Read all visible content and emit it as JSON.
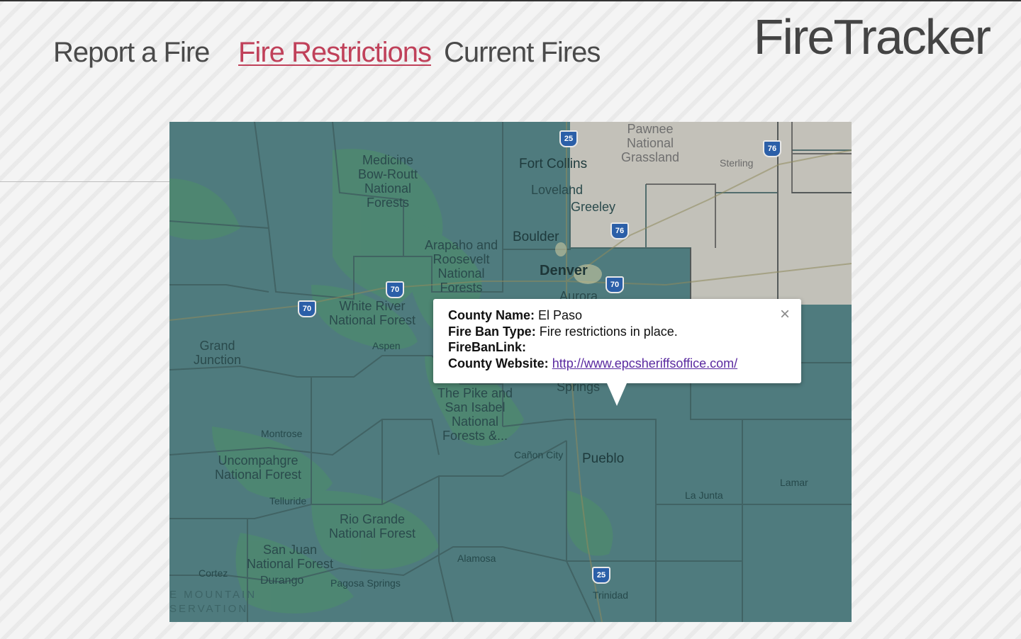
{
  "nav": {
    "report": "Report a Fire",
    "restrictions": "Fire Restrictions",
    "current": "Current Fires"
  },
  "brand": "FireTracker",
  "colors": {
    "accent": "#c0415a",
    "map_overlay": "#4e7a7d",
    "no_restriction_area": "#c9c5bd",
    "link": "#5a2aa0"
  },
  "map": {
    "labels": {
      "medicine_bow": "Medicine\nBow-Routt\nNational\nForests",
      "fort_collins": "Fort Collins",
      "loveland": "Loveland",
      "greeley": "Greeley",
      "pawnee": "Pawnee\nNational\nGrassland",
      "sterling": "Sterling",
      "boulder": "Boulder",
      "arapaho": "Arapaho and\nRoosevelt\nNational\nForests",
      "denver": "Denver",
      "aurora": "Aurora",
      "white_river": "White River\nNational Forest",
      "grand_junction": "Grand\nJunction",
      "aspen": "Aspen",
      "springs": "Springs",
      "pike_san_isabel": "The Pike and\nSan Isabel\nNational\nForests &...",
      "montrose": "Montrose",
      "uncompahgre": "Uncompahgre\nNational Forest",
      "canon_city": "Cañon City",
      "pueblo": "Pueblo",
      "la_junta": "La Junta",
      "lamar": "Lamar",
      "telluride": "Telluride",
      "rio_grande": "Rio Grande\nNational Forest",
      "san_juan": "San Juan\nNational Forest",
      "alamosa": "Alamosa",
      "cortez": "Cortez",
      "durango": "Durango",
      "pagosa_springs": "Pagosa Springs",
      "trinidad": "Trinidad",
      "ute_mountain": "E MOUNTAIN\nSERVATION"
    },
    "shields": {
      "i25_north": "25",
      "i76_ne": "76",
      "i76_mid": "76",
      "i70_west1": "70",
      "i70_west2": "70",
      "i70_east": "70",
      "i25_south": "25"
    }
  },
  "popup": {
    "county_name_label": "County Name:",
    "county_name": "El Paso",
    "fire_ban_type_label": "Fire Ban Type:",
    "fire_ban_type": "Fire restrictions in place.",
    "fire_ban_link_label": "FireBanLink:",
    "county_website_label": "County Website:",
    "county_website": "http://www.epcsheriffsoffice.com/",
    "close_icon": "×"
  }
}
